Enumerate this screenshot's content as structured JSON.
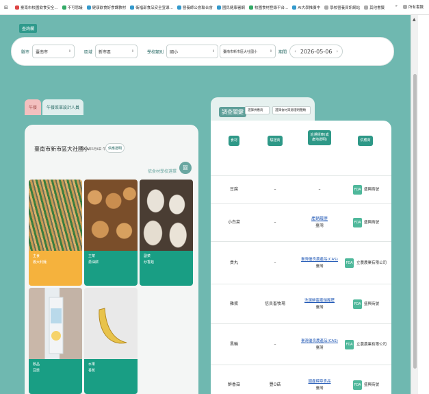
{
  "bookmarks": {
    "items": [
      {
        "label": "臺南市校園飲食安全...",
        "color": "#d44"
      },
      {
        "label": "不可思議",
        "color": "#3a6"
      },
      {
        "label": "健康飲食好食課教材",
        "color": "#39c"
      },
      {
        "label": "衛福部食品安全宣導...",
        "color": "#39c"
      },
      {
        "label": "營養師公會聯合會",
        "color": "#39c"
      },
      {
        "label": "國民健康署網",
        "color": "#39c"
      },
      {
        "label": "校園食材登錄平台...",
        "color": "#3a6"
      },
      {
        "label": "AI大學推廣中",
        "color": "#39c"
      },
      {
        "label": "學校營養資訊網站",
        "color": "#aaa"
      },
      {
        "label": "其他書籤",
        "color": "#aaa"
      }
    ],
    "more": "»",
    "all_label": "所有書籤"
  },
  "top_tab": "查詢欄",
  "filter": {
    "city_label": "縣市",
    "city_value": "臺南市",
    "district_label": "區域",
    "district_value": "新市區",
    "school_type_label": "學校類別",
    "school_type_value": "國小",
    "school_value": "臺南市新市區大社國小",
    "date_label": "期間",
    "date_value": "2026-05-06",
    "prev": "‹",
    "next": "›"
  },
  "left": {
    "tabs": [
      "午餐",
      "午餐菜單設計人員"
    ],
    "school_name": "臺南市新市區大社國小",
    "date_text": "2026年5月6日 午餐",
    "print_label": "供應證明",
    "sort_label": "依食材學校選擇",
    "sort_icon": "圓",
    "dishes": [
      {
        "type": "主食",
        "name": "義大利麵",
        "color": "#f5b23d"
      },
      {
        "type": "主菜",
        "name": "蔥油餅",
        "color": "#199e84"
      },
      {
        "type": "副菜",
        "name": "炒香菇",
        "color": "#199e84"
      },
      {
        "type": "飲品",
        "name": "豆漿",
        "color": "#199e84"
      },
      {
        "type": "水果",
        "name": "香蕉",
        "color": "#199e84"
      }
    ]
  },
  "right": {
    "title": "調查關鍵",
    "select1": "選擇供應商",
    "select2": "選擇食材來源證明種類",
    "headers": [
      "食材",
      "驗證商",
      "追溯標章(或產地證明)",
      "供應商"
    ],
    "rows": [
      {
        "ingredient": "豆腐",
        "verifier": "–",
        "cert": "–",
        "cert_origin": "",
        "supplier": "盛興商號"
      },
      {
        "ingredient": "小白菜",
        "verifier": "–",
        "cert": "產銷履歷",
        "cert_origin": "臺灣",
        "supplier": "盛興商號"
      },
      {
        "ingredient": "貢丸",
        "verifier": "–",
        "cert": "臺灣優良農產品(CAS)",
        "cert_origin": "臺灣",
        "supplier": "立農農業有限公司"
      },
      {
        "ingredient": "雞蛋",
        "verifier": "信良畜牧場",
        "cert": "洗選鮮蛋產銷履歷",
        "cert_origin": "臺灣",
        "supplier": "盛興商號"
      },
      {
        "ingredient": "黑輪",
        "verifier": "–",
        "cert": "臺灣優良農產品(CAS)",
        "cert_origin": "臺灣",
        "supplier": "立農農業有限公司"
      },
      {
        "ingredient": "鮮香菇",
        "verifier": "豐O菇",
        "cert": "國產標章食品",
        "cert_origin": "臺灣",
        "supplier": "盛興商號"
      }
    ],
    "fda_label": "FDA"
  },
  "scroll_up": "▲"
}
